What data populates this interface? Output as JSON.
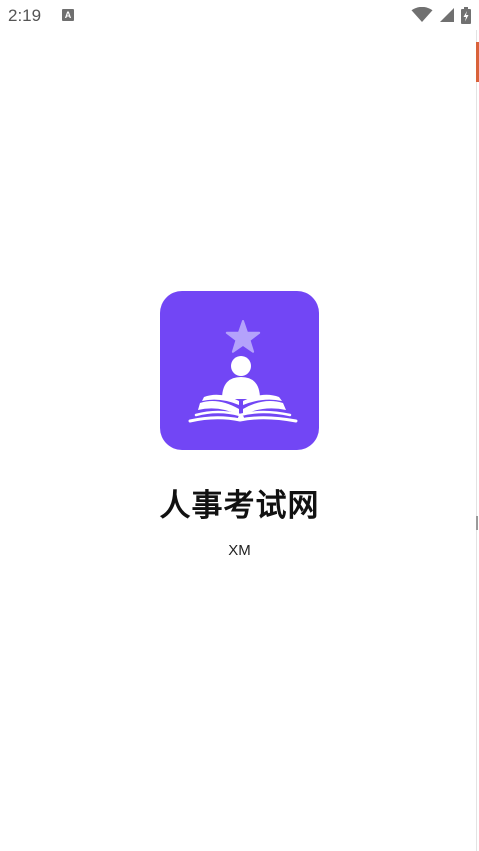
{
  "status_bar": {
    "time": "2:19",
    "notification_icon": "text-a-icon",
    "notification_glyph": "A",
    "icons": [
      "wifi-icon",
      "cellular-signal-icon",
      "battery-charging-icon"
    ]
  },
  "splash": {
    "app_icon": "book-reader-star-logo",
    "title": "人事考试网",
    "subtitle": "XM"
  },
  "colors": {
    "icon_background": "#7246f5",
    "star": "#b4a2fb",
    "accent_edge": "#d9623a"
  }
}
